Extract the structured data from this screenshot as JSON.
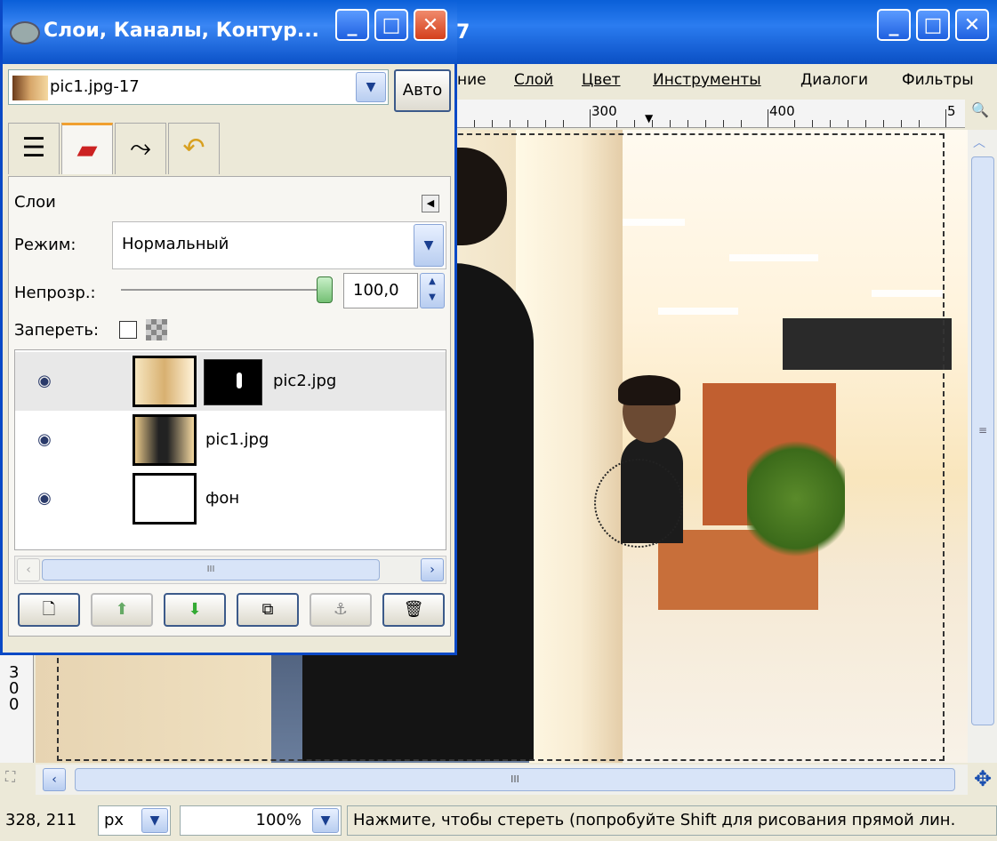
{
  "main_window": {
    "title_fragment": "7",
    "controls": {
      "minimize": "_",
      "maximize": "□",
      "close": "✕"
    },
    "menu": [
      "ние",
      "Слой",
      "Цвет",
      "Инструменты",
      "Диалоги",
      "Фильтры"
    ],
    "ruler": {
      "labels": [
        "300",
        "400",
        "5"
      ]
    },
    "vertical_ruler_label": "300",
    "hscroll_grip": "III",
    "vscroll_grip": "≡"
  },
  "statusbar": {
    "coords": "328, 211",
    "unit": "px",
    "zoom": "100%",
    "message": "Нажмите, чтобы стереть (попробуйте Shift для рисования прямой лин."
  },
  "layers_dialog": {
    "title": "Слои, Каналы, Контур...",
    "controls": {
      "minimize": "_",
      "maximize": "□",
      "close": "✕"
    },
    "image_selector": "pic1.jpg-17",
    "auto_button": "Авто",
    "tabs": [
      "layers-icon",
      "channels-icon",
      "paths-icon",
      "undo-history-icon"
    ],
    "panel_title": "Слои",
    "mode_label": "Режим:",
    "mode_value": "Нормальный",
    "opacity_label": "Непрозр.:",
    "opacity_value": "100,0",
    "opacity_level_percent": 100,
    "lock_label": "Запереть:",
    "layers": [
      {
        "name": "pic2.jpg",
        "has_mask": true,
        "visible": true,
        "selected": true
      },
      {
        "name": "pic1.jpg",
        "has_mask": false,
        "visible": true,
        "selected": false
      },
      {
        "name": "фон",
        "has_mask": false,
        "visible": true,
        "selected": false
      }
    ],
    "list_scroll_grip": "III",
    "buttons": [
      "new-layer-icon",
      "raise-layer-icon",
      "lower-layer-icon",
      "duplicate-layer-icon",
      "anchor-layer-icon",
      "delete-layer-icon"
    ]
  }
}
